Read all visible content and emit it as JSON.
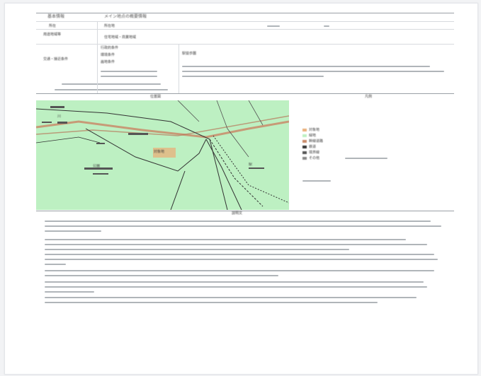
{
  "document": {
    "header_label": "基本情報",
    "header_title": "メイン地点の概要情報",
    "rows": [
      {
        "label": "所在",
        "value": "所在地"
      },
      {
        "label": "用途地域等",
        "value": "住宅地域・商業地域"
      },
      {
        "label": "交通・接近条件",
        "value": "駅徒歩圏"
      }
    ],
    "middle_labels": [
      "行政的条件",
      "環境条件",
      "画地条件"
    ],
    "map_caption": "位置図",
    "legend_caption": "凡例",
    "legend": [
      {
        "label": "対象地",
        "color": "#e9b07a"
      },
      {
        "label": "緑地",
        "color": "#bdf0c2"
      },
      {
        "label": "幹線道路",
        "color": "#c98b6a"
      },
      {
        "label": "鉄道",
        "color": "#333333"
      },
      {
        "label": "境界線",
        "color": "#555555"
      },
      {
        "label": "その他",
        "color": "#888888"
      }
    ],
    "map_labels": [
      "対象地",
      "公園",
      "駅",
      "川"
    ],
    "footer_caption": "説明文"
  },
  "colors": {
    "map_green": "#bdf0c2",
    "road": "#c98b6a",
    "rule": "#9aa0a6"
  }
}
